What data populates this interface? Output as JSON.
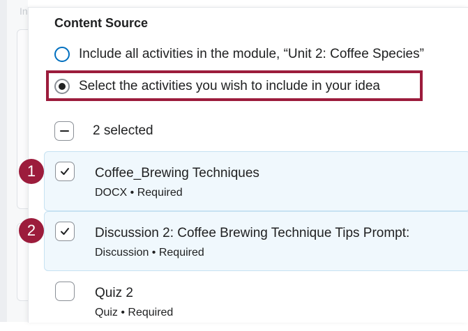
{
  "background": {
    "partial_text": "In"
  },
  "content_source": {
    "heading": "Content Source",
    "options": [
      {
        "label": "Include all activities in the module, “Unit 2: Coffee Species”",
        "selected": false
      },
      {
        "label": "Select the activities you wish to include in your idea",
        "selected": true
      }
    ]
  },
  "selection": {
    "count_label": "2 selected"
  },
  "activities": [
    {
      "title": "Coffee_Brewing Techniques",
      "meta": "DOCX • Required",
      "checked": true,
      "callout": "1"
    },
    {
      "title": "Discussion 2: Coffee Brewing Technique Tips Prompt:",
      "meta": "Discussion • Required",
      "checked": true,
      "callout": "2"
    },
    {
      "title": "Quiz 2",
      "meta": "Quiz • Required",
      "checked": false
    }
  ],
  "colors": {
    "callout": "#9c1c3c",
    "radio_accent": "#006fbf",
    "selected_row_bg": "#f0f8fd"
  }
}
